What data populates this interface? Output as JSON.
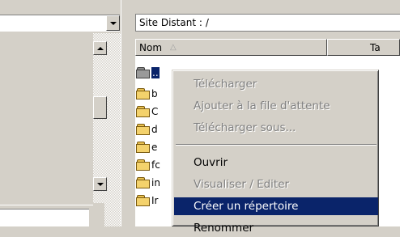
{
  "remote": {
    "site_label": "Site Distant :",
    "site_path": "/",
    "columns": [
      "Nom",
      "Ta"
    ],
    "files": [
      "..",
      "b",
      "C",
      "d",
      "e",
      "fc",
      "in",
      "Ir"
    ]
  },
  "context_menu": {
    "items": [
      {
        "label": "Télécharger",
        "enabled": false
      },
      {
        "label": "Ajouter à la file d'attente",
        "enabled": false
      },
      {
        "label": "Télécharger sous...",
        "enabled": false
      },
      {
        "label": "Ouvrir",
        "enabled": true
      },
      {
        "label": "Visualiser / Editer",
        "enabled": false
      },
      {
        "label": "Créer un répertoire",
        "enabled": true,
        "highlighted": true
      },
      {
        "label": "Renommer",
        "enabled": true
      }
    ]
  },
  "colors": {
    "highlight": "#0a246a",
    "chrome": "#d4d0c8",
    "folder": "#f4d26c"
  }
}
